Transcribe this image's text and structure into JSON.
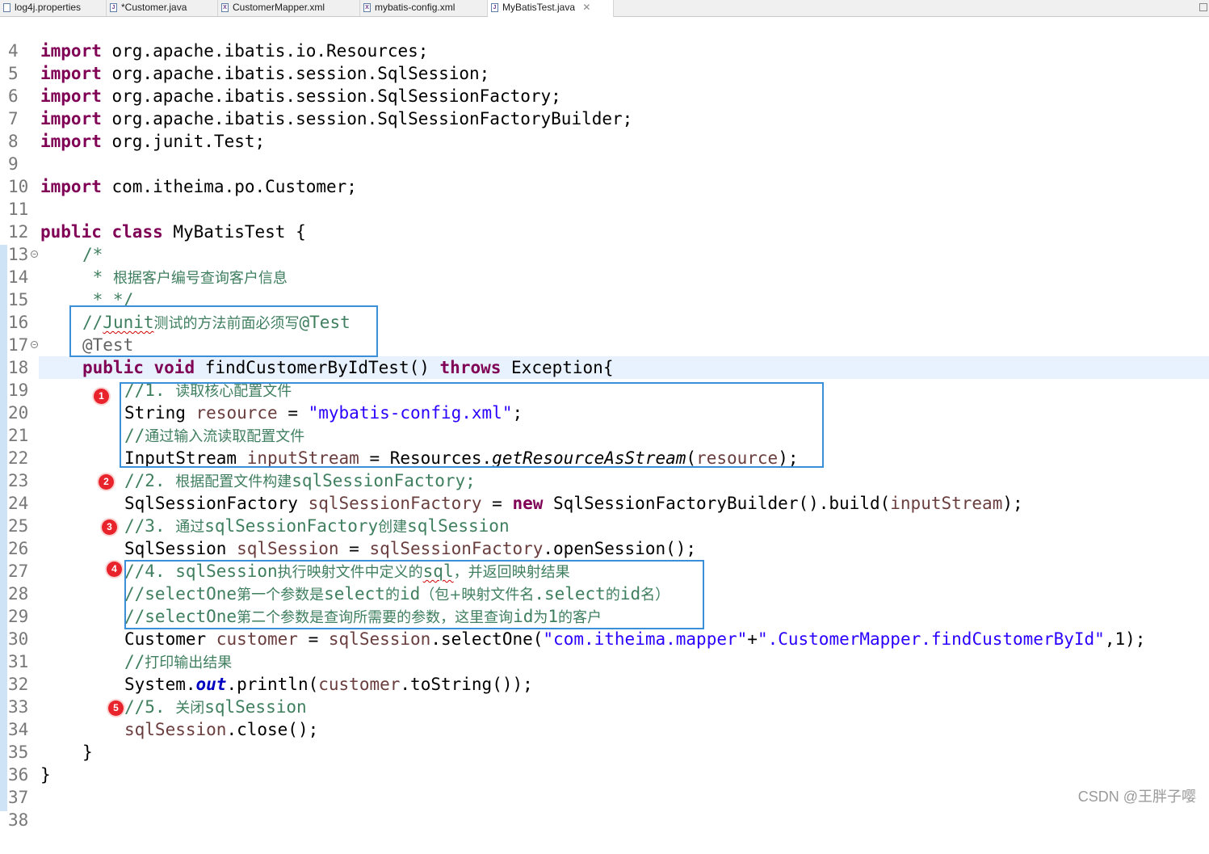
{
  "tabs": [
    {
      "label": "log4j.properties",
      "icon": "properties-file-icon"
    },
    {
      "label": "*Customer.java",
      "icon": "java-file-icon"
    },
    {
      "label": "CustomerMapper.xml",
      "icon": "xml-file-icon"
    },
    {
      "label": "mybatis-config.xml",
      "icon": "xml-file-icon"
    },
    {
      "label": "MyBatisTest.java",
      "icon": "java-file-icon",
      "active": true,
      "close": "✕"
    }
  ],
  "line_numbers": [
    "4",
    "5",
    "6",
    "7",
    "8",
    "9",
    "10",
    "11",
    "12",
    "13",
    "14",
    "15",
    "16",
    "17",
    "18",
    "19",
    "20",
    "21",
    "22",
    "23",
    "24",
    "25",
    "26",
    "27",
    "28",
    "29",
    "30",
    "31",
    "32",
    "33",
    "34",
    "35",
    "36",
    "37",
    "38"
  ],
  "code": {
    "l5": {
      "kw": "import",
      "rest": " org.apache.ibatis.io.Resources;"
    },
    "l6": {
      "kw": "import",
      "rest": " org.apache.ibatis.session.SqlSession;"
    },
    "l7": {
      "kw": "import",
      "rest": " org.apache.ibatis.session.SqlSessionFactory;"
    },
    "l8": {
      "kw": "import",
      "rest": " org.apache.ibatis.session.SqlSessionFactoryBuilder;"
    },
    "l9": {
      "kw": "import",
      "rest": " org.junit.Test;"
    },
    "l11": {
      "kw": "import",
      "rest": " com.itheima.po.Customer;"
    },
    "l13": {
      "kw1": "public",
      "kw2": "class",
      "rest": " MyBatisTest {"
    },
    "l14": "/*",
    "l15": {
      "star": " * ",
      "text": "根据客户编号查询客户信息"
    },
    "l16": " * */",
    "l17": {
      "a": "//",
      "b": "Junit",
      "c": "测试的方法前面必须写",
      "d": "@Test"
    },
    "l18": "@Test",
    "l19": {
      "kw1": "public",
      "kw2": "void",
      "mid": " findCustomerByIdTest() ",
      "kw3": "throws",
      "rest": " Exception{"
    },
    "l20": {
      "a": "//1. ",
      "b": "读取核心配置文件"
    },
    "l21": {
      "a": "String ",
      "v": "resource",
      "b": " = ",
      "s": "\"mybatis-config.xml\"",
      "c": ";"
    },
    "l22": {
      "a": "//",
      "b": "通过输入流读取配置文件"
    },
    "l23": {
      "a": "InputStream ",
      "v": "inputStream",
      "b": " = Resources.",
      "m": "getResourceAsStream",
      "c": "(",
      "v2": "resource",
      "d": ");"
    },
    "l24": {
      "a": "//2. ",
      "b": "根据配置文件构建",
      "c": "sqlSessionFactory;"
    },
    "l25": {
      "a": "SqlSessionFactory ",
      "v": "sqlSessionFactory",
      "b": " = ",
      "kw": "new",
      "c": " SqlSessionFactoryBuilder().build(",
      "v2": "inputStream",
      "d": ");"
    },
    "l26": {
      "a": "//3. ",
      "b": "通过",
      "c": "sqlSessionFactory",
      "d": "创建",
      "e": "sqlSession"
    },
    "l27": {
      "a": "SqlSession ",
      "v": "sqlSession",
      "b": " = ",
      "v2": "sqlSessionFactory",
      "c": ".openSession();"
    },
    "l28": {
      "a": "//4. sqlSession",
      "b": "执行映射文件中定义的",
      "c": "sql",
      "d": "，并返回映射结果"
    },
    "l29": {
      "a": "//selectOne",
      "b": "第一个参数是",
      "c": "select",
      "d": "的",
      "e": "id",
      "f": "（包+映射文件名",
      "g": ".select",
      "h": "的",
      "i": "id",
      "j": "名）"
    },
    "l30": {
      "a": "//selectOne",
      "b": "第二个参数是查询所需要的参数，这里查询",
      "c": "id",
      "d": "为",
      "e": "1",
      "f": "的客户"
    },
    "l31": {
      "a": "Customer ",
      "v": "customer",
      "b": " = ",
      "v2": "sqlSession",
      "c": ".selectOne(",
      "s1": "\"com.itheima.mapper\"",
      "d": "+",
      "s2": "\".CustomerMapper.findCustomerById\"",
      "e": ",1);"
    },
    "l32": {
      "a": "//",
      "b": "打印输出结果"
    },
    "l33": {
      "a": "System.",
      "f": "out",
      "b": ".println(",
      "v": "customer",
      "c": ".toString());"
    },
    "l34": {
      "a": "//5. ",
      "b": "关闭",
      "c": "sqlSession"
    },
    "l35": {
      "v": "sqlSession",
      "a": ".close();"
    },
    "l36": "}",
    "l37": "}"
  },
  "markers": [
    "1",
    "2",
    "3",
    "4",
    "5"
  ],
  "watermark": "CSDN @王胖子嘤",
  "colors": {
    "keyword": "#7f0055",
    "comment": "#3f7f5f",
    "string": "#2a00ff",
    "local_variable": "#6a3e3e",
    "static_field": "#0000c0",
    "annotation": "#646464",
    "highlight_box": "#3a8fd8",
    "marker": "#e8232b",
    "current_line": "#e8f2fe"
  }
}
